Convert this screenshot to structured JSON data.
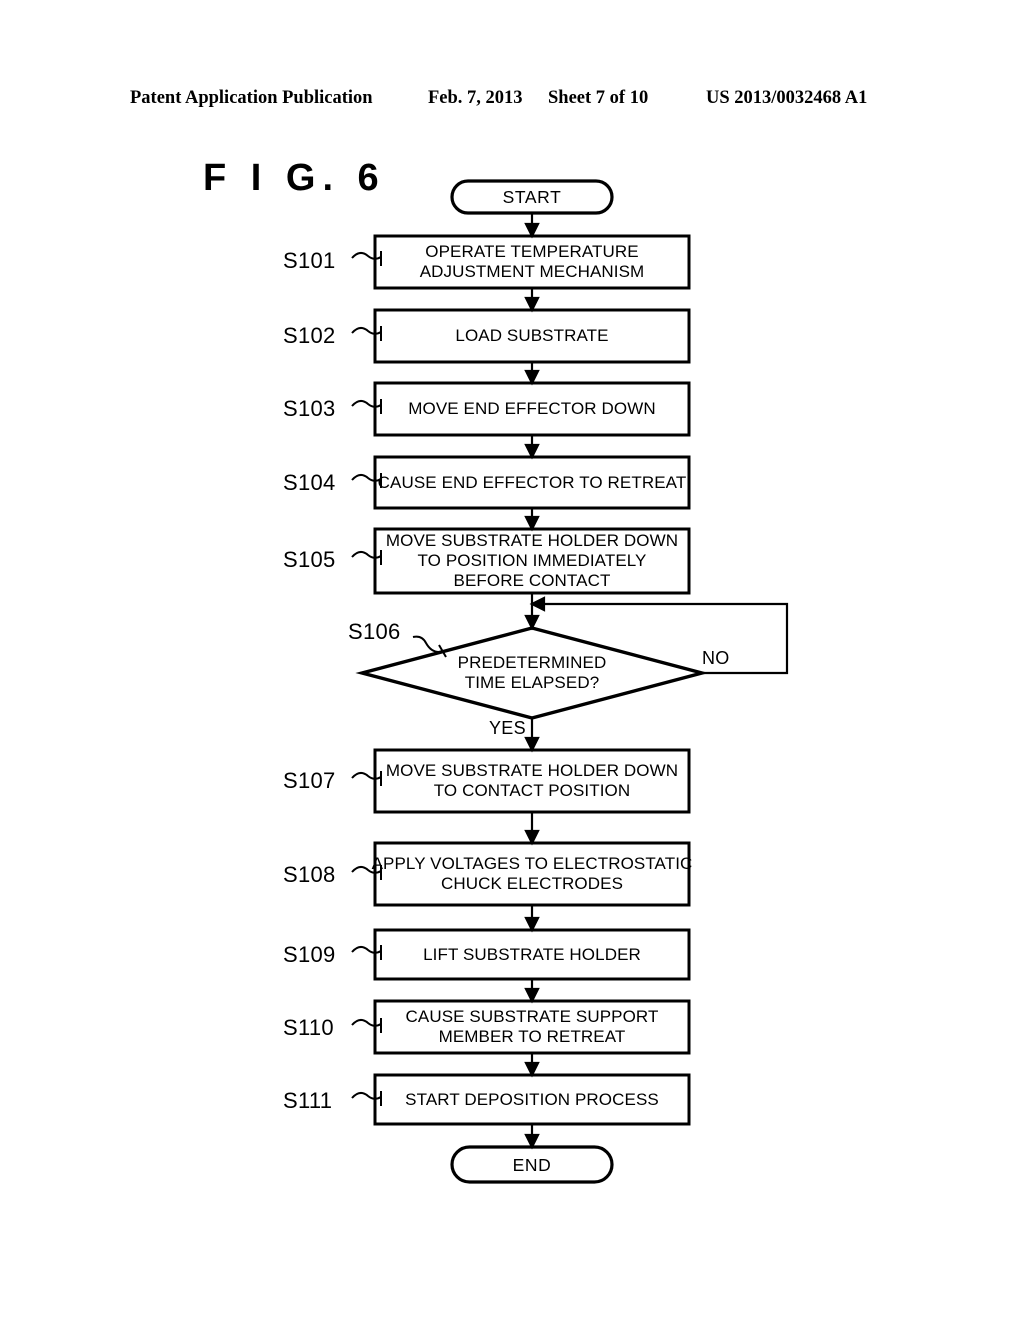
{
  "header": {
    "publication": "Patent Application Publication",
    "date": "Feb. 7, 2013",
    "sheet": "Sheet 7 of 10",
    "document_number": "US 2013/0032468 A1"
  },
  "figure": {
    "label": "F I G.  6"
  },
  "flowchart": {
    "start": {
      "label": "START"
    },
    "end": {
      "label": "END"
    },
    "steps": [
      {
        "id": "S101",
        "lines": [
          "OPERATE TEMPERATURE",
          "ADJUSTMENT MECHANISM"
        ]
      },
      {
        "id": "S102",
        "lines": [
          "LOAD SUBSTRATE"
        ]
      },
      {
        "id": "S103",
        "lines": [
          "MOVE END EFFECTOR DOWN"
        ]
      },
      {
        "id": "S104",
        "lines": [
          "CAUSE END EFFECTOR TO RETREAT"
        ]
      },
      {
        "id": "S105",
        "lines": [
          "MOVE SUBSTRATE HOLDER DOWN",
          "TO POSITION IMMEDIATELY",
          "BEFORE CONTACT"
        ]
      },
      {
        "id": "S107",
        "lines": [
          "MOVE SUBSTRATE HOLDER DOWN",
          "TO CONTACT POSITION"
        ]
      },
      {
        "id": "S108",
        "lines": [
          "APPLY VOLTAGES TO ELECTROSTATIC",
          "CHUCK ELECTRODES"
        ]
      },
      {
        "id": "S109",
        "lines": [
          "LIFT SUBSTRATE HOLDER"
        ]
      },
      {
        "id": "S110",
        "lines": [
          "CAUSE SUBSTRATE SUPPORT",
          "MEMBER TO RETREAT"
        ]
      },
      {
        "id": "S111",
        "lines": [
          "START DEPOSITION PROCESS"
        ]
      }
    ],
    "decision": {
      "id": "S106",
      "lines": [
        "PREDETERMINED",
        "TIME ELAPSED?"
      ],
      "yes_label": "YES",
      "no_label": "NO"
    }
  },
  "colors": {
    "ink": "#000000",
    "paper": "#ffffff"
  }
}
